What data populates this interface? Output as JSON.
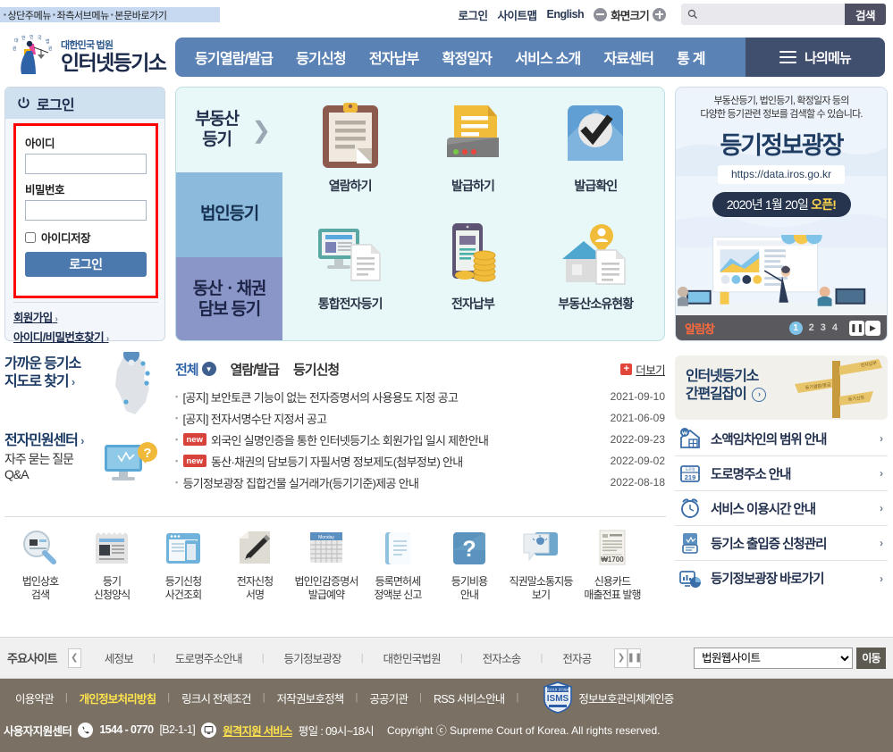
{
  "skipnav": {
    "items": [
      "상단주메뉴",
      "좌측서브메뉴",
      "본문바로가기"
    ]
  },
  "utilbar": {
    "login": "로그인",
    "sitemap": "사이트맵",
    "english": "English",
    "zoom_label": "화면크기",
    "search_placeholder": "",
    "search_value": "",
    "search_button": "검색"
  },
  "logo": {
    "line1": "대한민국 법원",
    "line2": "인터넷등기소"
  },
  "gnb": {
    "items": [
      {
        "label": "등기열람/발급"
      },
      {
        "label": "등기신청"
      },
      {
        "label": "전자납부"
      },
      {
        "label": "확정일자"
      },
      {
        "label": "서비스 소개"
      },
      {
        "label": "자료센터"
      },
      {
        "label": "통 계"
      }
    ],
    "mymenu": "나의메뉴"
  },
  "login": {
    "title": "로그인",
    "id_label": "아이디",
    "id_value": "",
    "pw_label": "비밀번호",
    "pw_value": "",
    "remember_label": "아이디저장",
    "submit": "로그인",
    "join": "회원가입",
    "find": "아이디/비밀번호찾기"
  },
  "services": {
    "categories": [
      {
        "label": "부동산\n등기"
      },
      {
        "label": "법인등기"
      },
      {
        "label": "동산ㆍ채권\n담보 등기"
      }
    ],
    "items": [
      {
        "label": "열람하기",
        "icon": "clipboard-icon"
      },
      {
        "label": "발급하기",
        "icon": "printer-doc-icon"
      },
      {
        "label": "발급확인",
        "icon": "check-doc-icon"
      },
      {
        "label": "통합전자등기",
        "icon": "monitor-doc-icon"
      },
      {
        "label": "전자납부",
        "icon": "mobile-coins-icon"
      },
      {
        "label": "부동산소유현황",
        "icon": "house-person-icon"
      }
    ]
  },
  "banner": {
    "desc_line1": "부동산등기, 법인등기, 확정일자 등의",
    "desc_line2": "다양한 등기관련 정보를 검색할 수 있습니다.",
    "title": "등기정보광장",
    "url": "https://data.iros.go.kr",
    "pill_prefix": "2020년 1월 20일",
    "pill_strong": "오픈!",
    "ctrl_label": "알림창",
    "pages": [
      "1",
      "2",
      "3",
      "4"
    ],
    "active_page": "1"
  },
  "leftmid": {
    "map_title": "가까운 등기소",
    "map_title2": "지도로 찾기",
    "minwon_title": "전자민원센터",
    "minwon_sub1": "자주 묻는 질문",
    "minwon_sub2": "Q&A"
  },
  "news": {
    "tabs": [
      {
        "label": "전체",
        "active": true
      },
      {
        "label": "열람/발급",
        "active": false
      },
      {
        "label": "등기신청",
        "active": false
      }
    ],
    "more": "더보기",
    "items": [
      {
        "badge": "",
        "title": "[공지] 보안토큰 기능이 없는 전자증명서의 사용용도 지정 공고",
        "date": "2021-09-10"
      },
      {
        "badge": "",
        "title": "[공지] 전자서명수단 지정서 공고",
        "date": "2021-06-09"
      },
      {
        "badge": "new",
        "title": "외국인 실명인증을 통한 인터넷등기소 회원가입 일시 제한안내",
        "date": "2022-09-23"
      },
      {
        "badge": "new",
        "title": "동산·채권의 담보등기 자필서명 정보제도(첨부정보) 안내",
        "date": "2022-09-02"
      },
      {
        "badge": "",
        "title": "등기정보광장 집합건물 실거래가(등기기준)제공 안내",
        "date": "2022-08-18"
      }
    ]
  },
  "rightcol": {
    "guide_line1": "인터넷등기소",
    "guide_line2": "간편길잡이",
    "signpost_labels": [
      "등기열람/발급",
      "전자납부",
      "등기신청"
    ],
    "links": [
      {
        "label": "소액임차인의 범위 안내",
        "icon": "house-won-icon"
      },
      {
        "label": "도로명주소 안내",
        "icon": "address-219-icon"
      },
      {
        "label": "서비스 이용시간 안내",
        "icon": "alarm-clock-icon"
      },
      {
        "label": "등기소 출입증 신청관리",
        "icon": "id-card-icon"
      },
      {
        "label": "등기정보광장 바로가기",
        "icon": "chart-monitor-icon"
      }
    ]
  },
  "iconrow": {
    "items": [
      {
        "line1": "법인상호",
        "line2": "검색",
        "icon": "magnifier-doc-icon"
      },
      {
        "line1": "등기",
        "line2": "신청양식",
        "icon": "form-paper-icon"
      },
      {
        "line1": "등기신청",
        "line2": "사건조회",
        "icon": "browser-mobile-icon"
      },
      {
        "line1": "전자신청",
        "line2": "서명",
        "icon": "pen-sign-icon"
      },
      {
        "line1": "법인인감증명서",
        "line2": "발급예약",
        "icon": "calendar-icon"
      },
      {
        "line1": "등록면허세",
        "line2": "정액분 신고",
        "icon": "book-icon"
      },
      {
        "line1": "등기비용",
        "line2": "안내",
        "icon": "question-icon"
      },
      {
        "line1": "직권말소통지등",
        "line2": "보기",
        "icon": "speech-bell-icon"
      },
      {
        "line1": "신용카드",
        "line2": "매출전표 발행",
        "icon": "receipt-icon"
      }
    ],
    "receipt_amount": "₩1700"
  },
  "sitesbar": {
    "label": "주요사이트",
    "links": [
      "세정보",
      "도로명주소안내",
      "등기정보광장",
      "대한민국법원",
      "전자소송",
      "전자공"
    ],
    "select_value": "법원웹사이트",
    "select_options": [
      "법원웹사이트"
    ],
    "go_button": "이동"
  },
  "footer": {
    "links": [
      {
        "label": "이용약관",
        "highlight": false
      },
      {
        "label": "개인정보처리방침",
        "highlight": true
      },
      {
        "label": "링크시 전제조건",
        "highlight": false
      },
      {
        "label": "저작권보호정책",
        "highlight": false
      },
      {
        "label": "공공기관",
        "highlight": false
      },
      {
        "label": "RSS 서비스안내",
        "highlight": false
      }
    ],
    "isms_badge": "ISMS",
    "isms_label": "정보보호관리체계인증",
    "support_label": "사용자지원센터",
    "phone": "1544 - 0770",
    "ext": "[B2-1-1]",
    "remote_label": "원격지원 서비스",
    "hours": "평일 : 09시~18시",
    "copyright": "Copyright ⓒ Supreme Court of Korea. All rights reserved."
  },
  "colors": {
    "gnb": "#5b82b4",
    "mymenu": "#414f6e",
    "accent_red": "#d9413b",
    "footer_bg": "#7a7164",
    "highlight_yellow": "#ffe34d"
  }
}
